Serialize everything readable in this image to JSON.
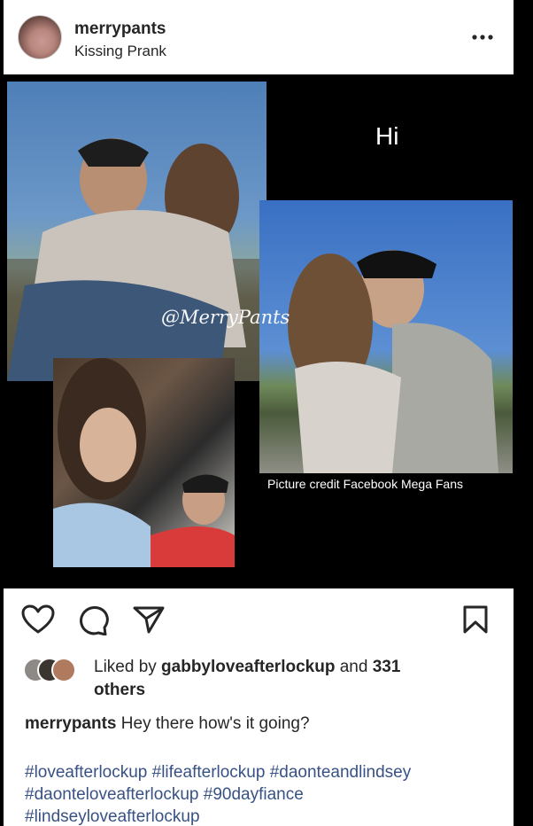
{
  "post": {
    "username": "merrypants",
    "subtitle": "Kissing Prank"
  },
  "media": {
    "overlay_text": "Hi",
    "watermark": "@MerryPants",
    "credit": "Picture credit Facebook Mega Fans"
  },
  "icons": [
    "heart-icon",
    "comment-icon",
    "share-icon",
    "bookmark-icon",
    "more-icon"
  ],
  "likes": {
    "prefix": "Liked by ",
    "user": "gabbyloveafterlockup",
    "middle": " and ",
    "count": "331",
    "suffix": "others"
  },
  "caption": {
    "user": "merrypants",
    "text": "Hey there how's it going?"
  },
  "hashtags": {
    "line1": "#loveafterlockup #lifeafterlockup #daonteandlindsey",
    "line2": "#daonteloveafterlockup #90dayfiance",
    "line3": "#lindseyloveafterlockup"
  },
  "colors": {
    "text": "#262626",
    "link": "#385185",
    "background": "#000000",
    "card": "#ffffff"
  }
}
